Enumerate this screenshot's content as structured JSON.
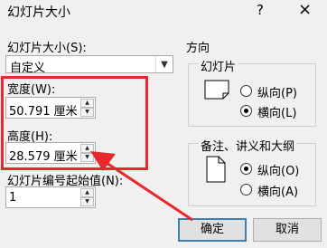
{
  "title": "幻灯片大小",
  "help_icon": "?",
  "close_icon": "×",
  "slide_size_label": "幻灯片大小(S):",
  "slide_size_value": "自定义",
  "width_label": "宽度(W):",
  "width_value": "50.791 厘米",
  "height_label": "高度(H):",
  "height_value": "28.579 厘米",
  "start_number_label": "幻灯片编号起始值(N):",
  "start_number_value": "1",
  "orientation": {
    "title": "方向",
    "slides_group": "幻灯片",
    "slides_portrait": "纵向(P)",
    "slides_landscape": "横向(L)",
    "notes_group": "备注、讲义和大纲",
    "notes_portrait": "纵向(O)",
    "notes_landscape": "横向(A)"
  },
  "ok_label": "确定",
  "cancel_label": "取消",
  "annotation_color": "#e8282b"
}
